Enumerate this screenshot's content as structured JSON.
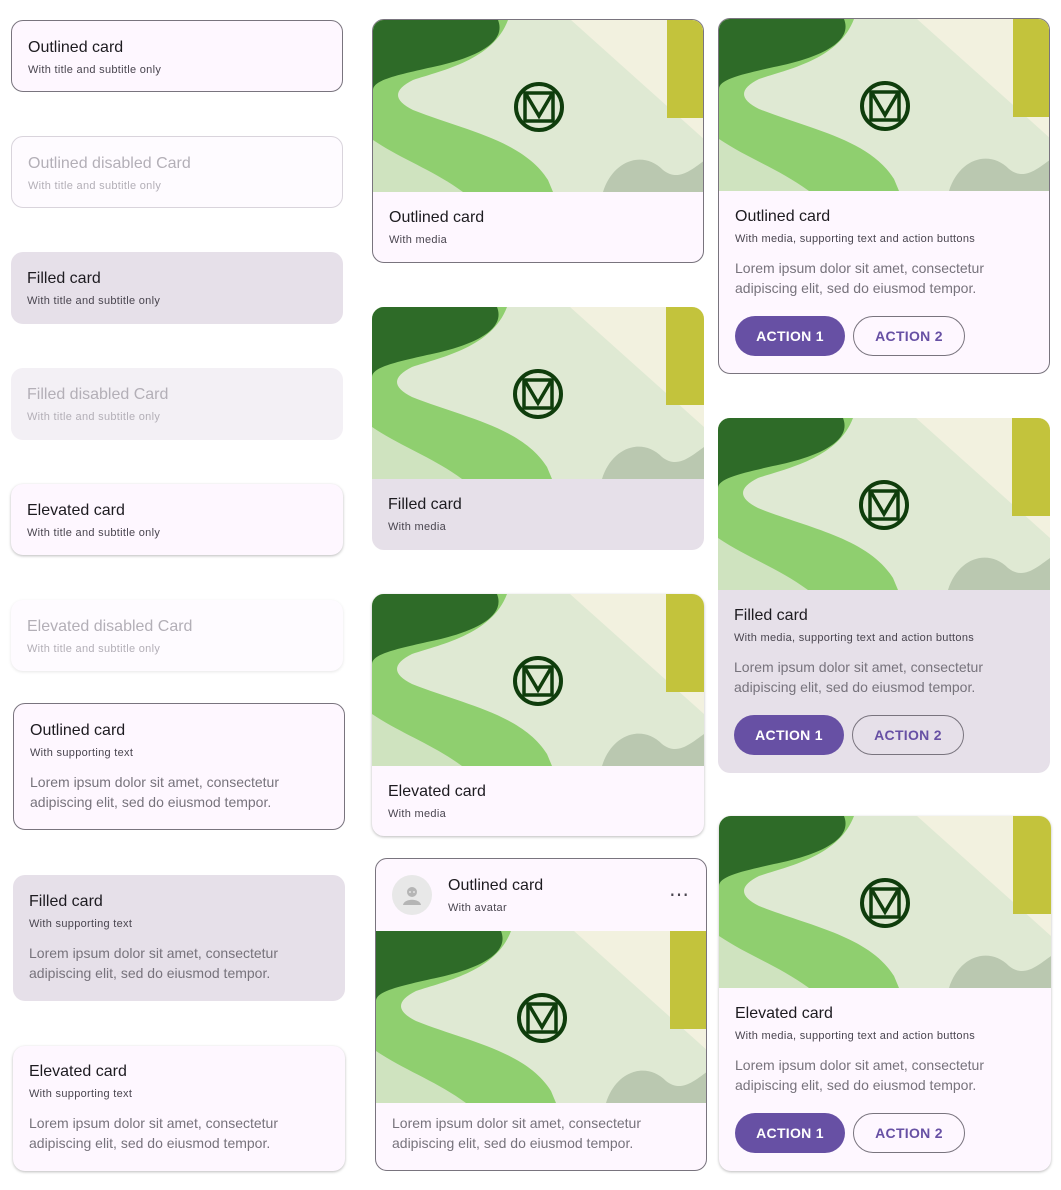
{
  "colors": {
    "primary": "#6750a4",
    "surface": "#fef7ff",
    "filled": "#e6e0e9",
    "outline": "#79747e",
    "media_dark_green": "#2e6b28",
    "media_light_green": "#8fcf6f",
    "media_pale": "#dfe9d3",
    "media_yellow": "#c3c33c"
  },
  "icons": {
    "media_logo": "circle-m-logo-icon",
    "avatar": "person-avatar-icon",
    "more": "more-horizontal-icon"
  },
  "lorem": "Lorem ipsum dolor sit amet, consectetur adipiscing elit, sed do eiusmod tempor.",
  "col1": {
    "outlined": {
      "title": "Outlined card",
      "subtitle": "With title and subtitle only"
    },
    "outlined_disabled": {
      "title": "Outlined disabled Card",
      "subtitle": "With title and subtitle only"
    },
    "filled": {
      "title": "Filled card",
      "subtitle": "With title and subtitle only"
    },
    "filled_disabled": {
      "title": "Filled disabled Card",
      "subtitle": "With title and subtitle only"
    },
    "elevated": {
      "title": "Elevated card",
      "subtitle": "With title and subtitle only"
    },
    "elevated_disabled": {
      "title": "Elevated disabled Card",
      "subtitle": "With title and subtitle only"
    },
    "outlined_support": {
      "title": "Outlined card",
      "subtitle": "With supporting text"
    },
    "filled_support": {
      "title": "Filled card",
      "subtitle": "With supporting text"
    },
    "elevated_support": {
      "title": "Elevated card",
      "subtitle": "With supporting text"
    }
  },
  "col2": {
    "outlined_media": {
      "title": "Outlined card",
      "subtitle": "With media"
    },
    "filled_media": {
      "title": "Filled card",
      "subtitle": "With media"
    },
    "elevated_media": {
      "title": "Elevated card",
      "subtitle": "With media"
    },
    "avatar_card": {
      "title": "Outlined card",
      "subtitle": "With avatar",
      "more": "⋯"
    }
  },
  "col3": {
    "outlined_full": {
      "title": "Outlined card",
      "subtitle": "With media, supporting text and action buttons"
    },
    "filled_full": {
      "title": "Filled card",
      "subtitle": "With media, supporting text and action buttons"
    },
    "elevated_full": {
      "title": "Elevated card",
      "subtitle": "With media, supporting text and action buttons"
    }
  },
  "actions": {
    "action1": "ACTION 1",
    "action2": "ACTION 2"
  }
}
